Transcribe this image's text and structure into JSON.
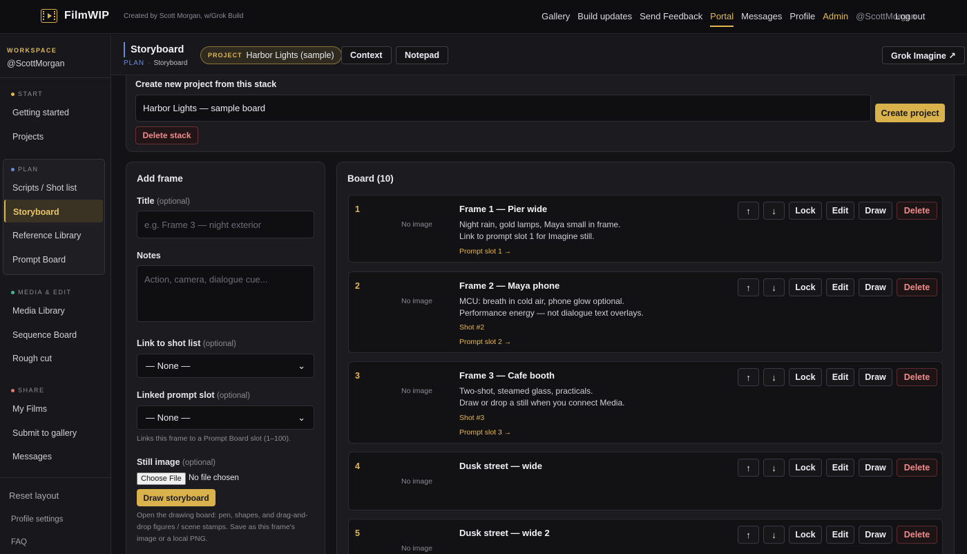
{
  "topbar": {
    "brand": "FilmWIP",
    "credit": "Created by Scott Morgan, w/Grok Build",
    "nav": [
      "Gallery",
      "Build updates",
      "Send Feedback",
      "Portal",
      "Messages",
      "Profile",
      "Admin",
      "@ScottMorgan"
    ],
    "logout": "Log out"
  },
  "sidebar": {
    "workspace_label": "WORKSPACE",
    "workspace_user": "@ScottMorgan",
    "start_label": "START",
    "start_items": [
      "Getting started",
      "Projects"
    ],
    "plan_label": "PLAN",
    "plan_items": [
      "Scripts / Shot list",
      "Storyboard",
      "Reference Library",
      "Prompt Board"
    ],
    "media_label": "MEDIA & EDIT",
    "media_items": [
      "Media Library",
      "Sequence Board",
      "Rough cut"
    ],
    "share_label": "SHARE",
    "share_items": [
      "My Films",
      "Submit to gallery",
      "Messages"
    ],
    "reset": "Reset layout",
    "profile_settings": "Profile settings",
    "faq": "FAQ",
    "colors": {
      "start": "#e1b84f",
      "plan": "#6c8bd6",
      "media": "#4fb39a",
      "share": "#e07a6a"
    }
  },
  "header": {
    "title": "Storyboard",
    "crumb_plan": "PLAN",
    "crumb_sep": "·",
    "crumb_page": "Storyboard",
    "project_key": "PROJECT",
    "project_name": "Harbor Lights (sample)",
    "context": "Context",
    "notepad": "Notepad",
    "grok": "Grok Imagine ↗"
  },
  "create": {
    "label": "Create new project from this stack",
    "value": "Harbor Lights — sample board",
    "button": "Create project",
    "delete": "Delete stack"
  },
  "add_frame": {
    "title": "Add frame",
    "title_label": "Title",
    "title_opt": "(optional)",
    "title_placeholder": "e.g. Frame 3 — night exterior",
    "notes_label": "Notes",
    "notes_placeholder": "Action, camera, dialogue cue...",
    "shot_label": "Link to shot list",
    "shot_opt": "(optional)",
    "shot_value": "— None —",
    "prompt_label": "Linked prompt slot",
    "prompt_opt": "(optional)",
    "prompt_value": "— None —",
    "prompt_hint": "Links this frame to a Prompt Board slot (1–100).",
    "still_label": "Still image",
    "still_opt": "(optional)",
    "choose_file": "Choose File",
    "no_file": "No file chosen",
    "draw_button": "Draw storyboard",
    "draw_hint": "Open the drawing board: pen, shapes, and drag-and-drop figures / scene stamps. Save as this frame's image or a local PNG."
  },
  "board": {
    "title": "Board (10)",
    "no_image": "No image",
    "actions": {
      "up": "↑",
      "down": "↓",
      "lock": "Lock",
      "edit": "Edit",
      "draw": "Draw",
      "delete": "Delete"
    },
    "frames": [
      {
        "num": "1",
        "title": "Frame 1 — Pier wide",
        "lines": [
          "Night rain, gold lamps, Maya small in frame.",
          "Link to prompt slot 1 for Imagine still."
        ],
        "shot": "",
        "prompt": "Prompt slot 1 →"
      },
      {
        "num": "2",
        "title": "Frame 2 — Maya phone",
        "lines": [
          "MCU: breath in cold air, phone glow optional.",
          "Performance energy — not dialogue text overlays."
        ],
        "shot": "Shot #2",
        "prompt": "Prompt slot 2 →"
      },
      {
        "num": "3",
        "title": "Frame 3 — Cafe booth",
        "lines": [
          "Two-shot, steamed glass, practicals.",
          "Draw or drop a still when you connect Media."
        ],
        "shot": "Shot #3",
        "prompt": "Prompt slot 3 →"
      },
      {
        "num": "4",
        "title": "Dusk street — wide",
        "lines": [],
        "shot": "",
        "prompt": ""
      },
      {
        "num": "5",
        "title": "Dusk street — wide 2",
        "lines": [],
        "shot": "",
        "prompt": ""
      }
    ]
  }
}
